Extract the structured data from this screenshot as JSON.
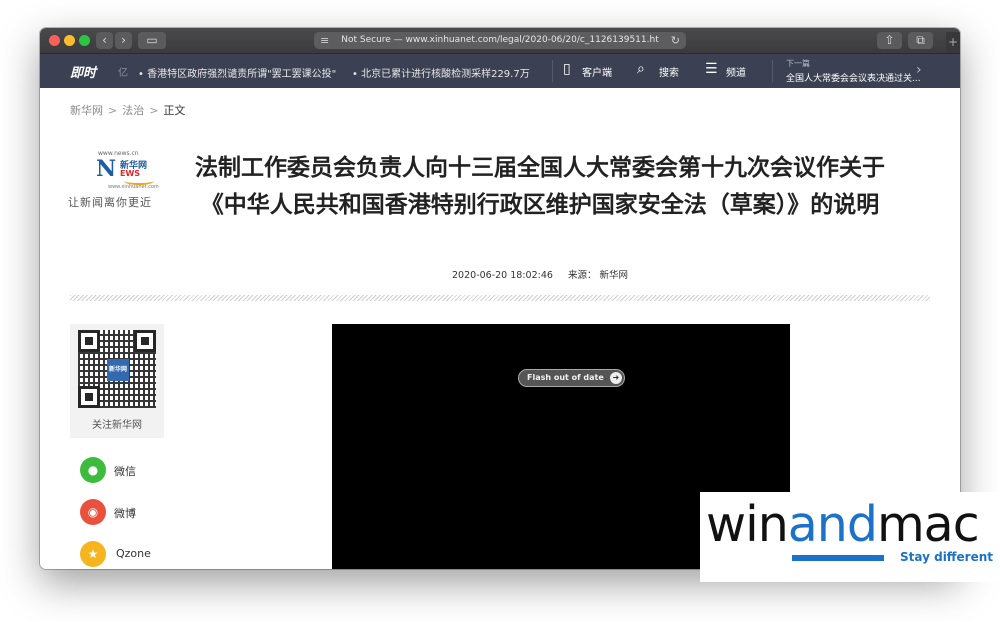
{
  "browser": {
    "url": "Not Secure — www.xinhuanet.com/legal/2020-06/20/c_1126139511.ht",
    "new_tab": "+"
  },
  "sitebar": {
    "logo": "即时",
    "logo_b": "亿",
    "ticker": [
      "• 香港特区政府强烈谴责所谓\"罢工罢课公投\"",
      "• 北京已累计进行核酸检测采样229.7万"
    ],
    "nav": [
      {
        "icon": "phone-icon",
        "label": "客户端"
      },
      {
        "icon": "search-icon",
        "label": "搜索"
      },
      {
        "icon": "menu-icon",
        "label": "频道"
      }
    ],
    "next_label": "下一篇",
    "next_title": "全国人大常委会会议表决通过关..."
  },
  "breadcrumb": {
    "items": [
      "新华网",
      "法治"
    ],
    "current": "正文",
    "separator": ">"
  },
  "logo": {
    "small": "www.news.cn",
    "n": "N",
    "cn": "新华网",
    "ews": "EWS",
    "url": "www.xinhuanet.com",
    "slogan": "让新闻离你更近"
  },
  "article": {
    "title": "法制工作委员会负责人向十三届全国人大常委会第十九次会议作关于《中华人民共和国香港特别行政区维护国家安全法（草案）》的说明",
    "date": "2020-06-20 18:02:46",
    "source": "来源： 新华网"
  },
  "qr": {
    "center": "新华网",
    "label": "关注新华网"
  },
  "share": [
    {
      "name": "微信",
      "icon": "wechat-icon"
    },
    {
      "name": "微博",
      "icon": "weibo-icon"
    },
    {
      "name": "Qzone",
      "icon": "qzone-icon"
    }
  ],
  "video": {
    "flash_message": "Flash out of date"
  },
  "watermark": {
    "win": "win",
    "and": "and",
    "mac": "mac",
    "tagline": "Stay different"
  }
}
